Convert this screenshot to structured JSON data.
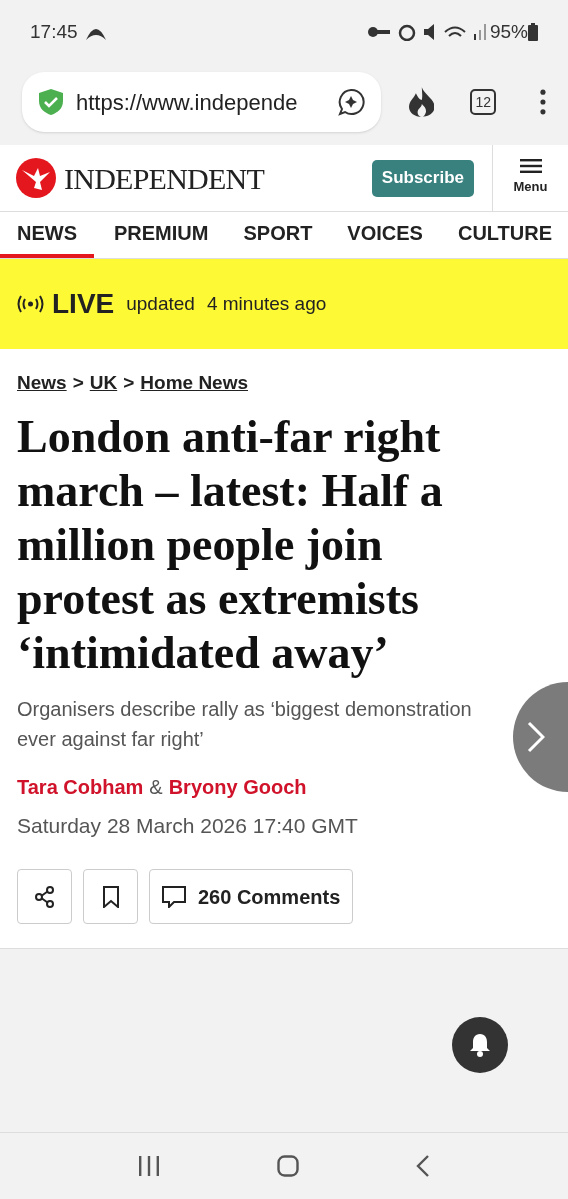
{
  "status_bar": {
    "time": "17:45",
    "battery": "95%"
  },
  "browser": {
    "url": "https://www.independe",
    "tab_count": "12"
  },
  "header": {
    "logo": "INDEPENDENT",
    "subscribe": "Subscribe",
    "menu": "Menu"
  },
  "nav": [
    {
      "label": "NEWS",
      "selected": true
    },
    {
      "label": "PREMIUM",
      "selected": false
    },
    {
      "label": "SPORT",
      "selected": false
    },
    {
      "label": "VOICES",
      "selected": false
    },
    {
      "label": "CULTURE",
      "selected": false
    }
  ],
  "live": {
    "label": "LIVE",
    "updated": "updated",
    "ago": "4 minutes ago"
  },
  "breadcrumb": [
    "News",
    "UK",
    "Home News"
  ],
  "breadcrumb_separator": ">",
  "headline": "London anti-far right march – latest: Half a million people join protest as extremists ‘intimidated away’",
  "standfirst": "Organisers describe rally as ‘biggest demonstration ever against far right’",
  "authors": [
    "Tara Cobham",
    "Bryony Gooch"
  ],
  "author_joiner": "&",
  "date": "Saturday 28 March 2026 17:40 GMT",
  "comments": "260 Comments"
}
